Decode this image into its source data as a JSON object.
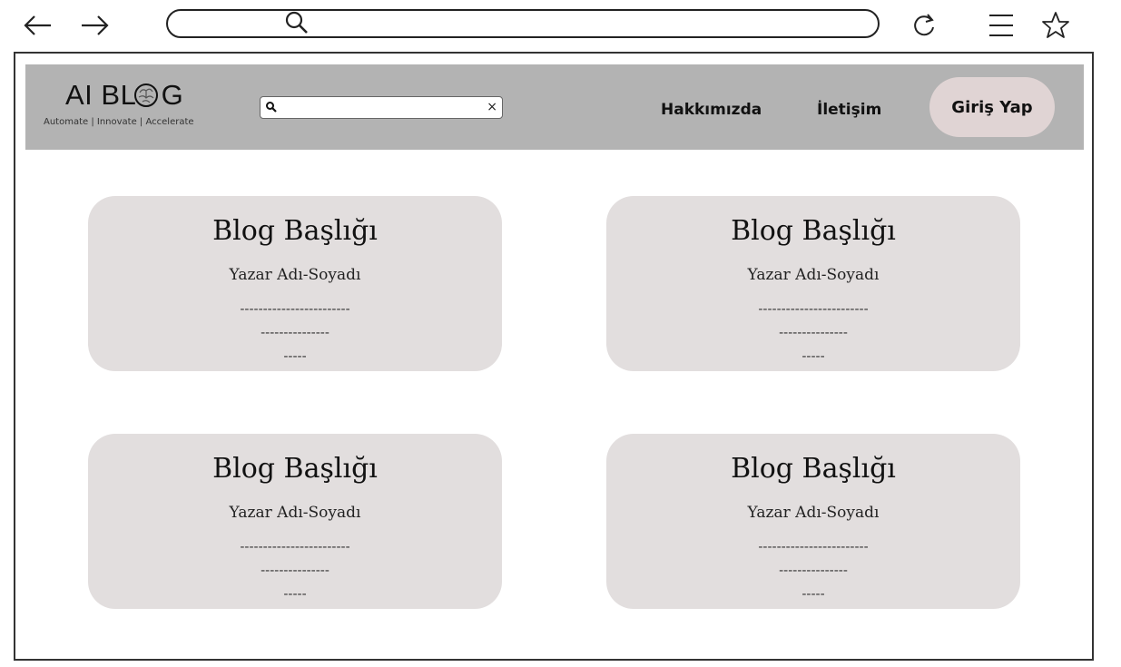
{
  "browser": {
    "back_icon": "arrow-left-icon",
    "forward_icon": "arrow-right-icon",
    "url_search_icon": "search-icon",
    "reload_icon": "reload-icon",
    "menu_icon": "hamburger-menu-icon",
    "bookmark_icon": "star-icon"
  },
  "header": {
    "logo_title": "AI BL   G",
    "logo_tagline": "Automate | Innovate | Accelerate",
    "search": {
      "value": "",
      "placeholder": "",
      "clear_label": "×"
    },
    "nav": {
      "about": "Hakkımızda",
      "contact": "İletişim"
    },
    "login_label": "Giriş  Yap"
  },
  "cards": [
    {
      "title": "Blog Başlığı",
      "author": "Yazar Adı-Soyadı",
      "line1": "------------------------",
      "line2": "---------------",
      "line3": "-----"
    },
    {
      "title": "Blog Başlığı",
      "author": "Yazar Adı-Soyadı",
      "line1": "------------------------",
      "line2": "---------------",
      "line3": "-----"
    },
    {
      "title": "Blog Başlığı",
      "author": "Yazar Adı-Soyadı",
      "line1": "------------------------",
      "line2": "---------------",
      "line3": "-----"
    },
    {
      "title": "Blog Başlığı",
      "author": "Yazar Adı-Soyadı",
      "line1": "------------------------",
      "line2": "---------------",
      "line3": "-----"
    }
  ],
  "colors": {
    "header_bg": "#b3b3b3",
    "card_bg": "#e2dede",
    "login_bg": "#e0d4d4"
  }
}
